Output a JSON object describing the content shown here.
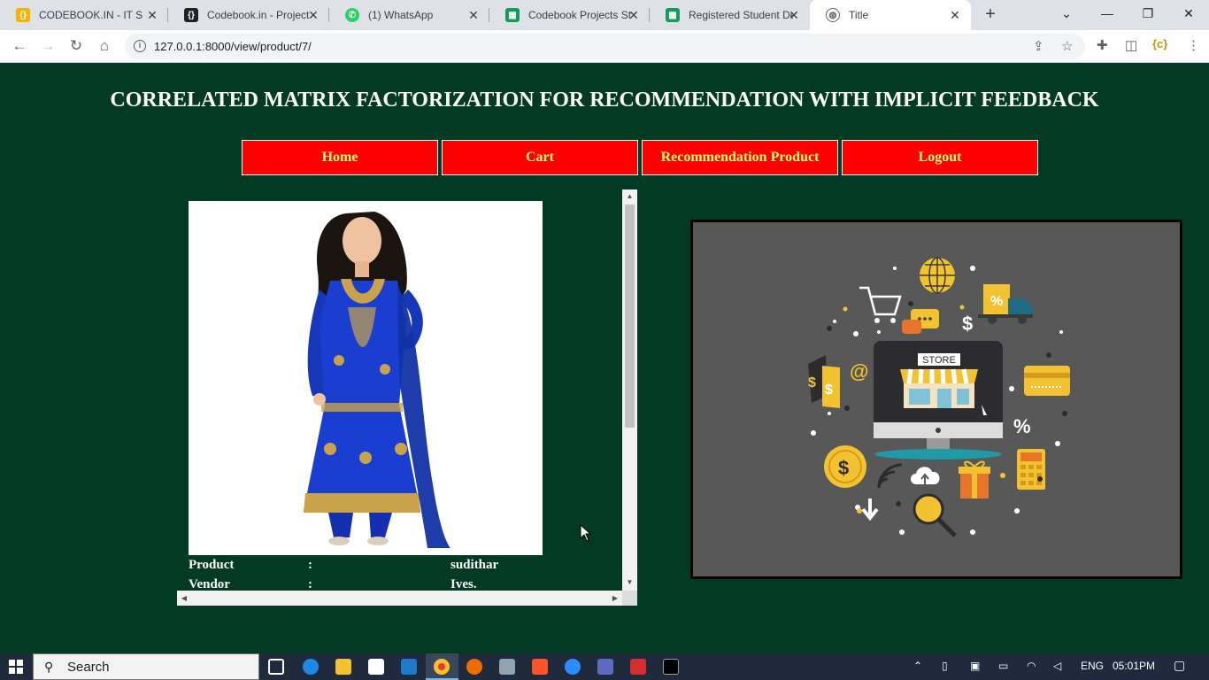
{
  "browser": {
    "tabs": [
      {
        "label": "CODEBOOK.IN - IT SE",
        "favicon": "codebook-icon",
        "color": "#f4b400"
      },
      {
        "label": "Codebook.in - Project",
        "favicon": "codebook-icon",
        "color": "#202124"
      },
      {
        "label": "(1) WhatsApp",
        "favicon": "whatsapp-icon",
        "color": "#25d366"
      },
      {
        "label": "Codebook Projects St",
        "favicon": "sheets-icon",
        "color": "#0f9d58"
      },
      {
        "label": "Registered Student De",
        "favicon": "sheets-icon",
        "color": "#0f9d58"
      },
      {
        "label": "Title",
        "favicon": "globe-icon",
        "color": "#5f6368"
      }
    ],
    "url": "127.0.0.1:8000/view/product/7/"
  },
  "page": {
    "title": "CORRELATED MATRIX FACTORIZATION FOR RECOMMENDATION WITH IMPLICIT FEEDBACK",
    "menu": {
      "home": "Home",
      "cart": "Cart",
      "recommendation": "Recommendation Product",
      "logout": "Logout"
    },
    "product": {
      "rows": [
        {
          "key": "Product",
          "sep": ":",
          "value": "sudithar"
        },
        {
          "key": "Vendor",
          "sep": ":",
          "value": "Ives."
        }
      ]
    },
    "store_graphic": {
      "store_label": "STORE",
      "percent_label": "%",
      "dollar_label": "$",
      "at_label": "@"
    }
  },
  "taskbar": {
    "search_placeholder": "Search",
    "language": "ENG",
    "time": "05:01PM"
  },
  "colors": {
    "page_background": "#033a24",
    "menu_button": "#ff0000",
    "menu_text": "#ffff66"
  }
}
